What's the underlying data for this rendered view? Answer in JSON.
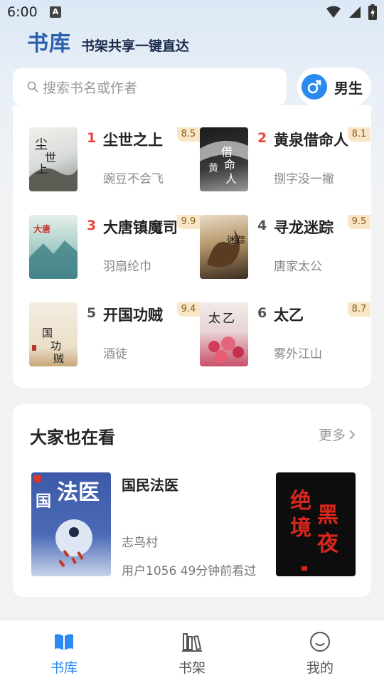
{
  "status_bar": {
    "time": "6:00",
    "notification_icon_text": "A"
  },
  "header": {
    "title": "书库",
    "slogan": "书架共享一键直达"
  },
  "search": {
    "placeholder": "搜索书名或作者"
  },
  "gender_toggle": {
    "label": "男生",
    "icon": "male-symbol-icon",
    "color": "#2a8af0"
  },
  "ranking": {
    "items": [
      {
        "rank": "1",
        "title": "尘世之上",
        "author": "豌豆不会飞",
        "score": "8.5",
        "rank_color": "#e8453c"
      },
      {
        "rank": "2",
        "title": "黄泉借命人",
        "author": "捌字没一撇",
        "score": "8.1",
        "rank_color": "#e8453c"
      },
      {
        "rank": "3",
        "title": "大唐镇魔司",
        "author": "羽扇纶巾",
        "score": "9.9",
        "rank_color": "#e8453c"
      },
      {
        "rank": "4",
        "title": "寻龙迷踪",
        "author": "唐家太公",
        "score": "9.5",
        "rank_color": "#555555"
      },
      {
        "rank": "5",
        "title": "开国功贼",
        "author": "酒徒",
        "score": "9.4",
        "rank_color": "#555555"
      },
      {
        "rank": "6",
        "title": "太乙",
        "author": "雾外江山",
        "score": "8.7",
        "rank_color": "#555555"
      }
    ]
  },
  "also_reading": {
    "title": "大家也在看",
    "more_label": "更多",
    "book": {
      "title": "国民法医",
      "author": "志鸟村",
      "meta": "用户1056 49分钟前看过"
    },
    "side_book_cover_text": "绝境黑夜"
  },
  "bottom_nav": {
    "active_color": "#2a8af0",
    "items": [
      {
        "label": "书库",
        "icon": "book-open-icon",
        "active": true
      },
      {
        "label": "书架",
        "icon": "bookshelf-icon",
        "active": false
      },
      {
        "label": "我的",
        "icon": "smiley-face-icon",
        "active": false
      }
    ]
  }
}
